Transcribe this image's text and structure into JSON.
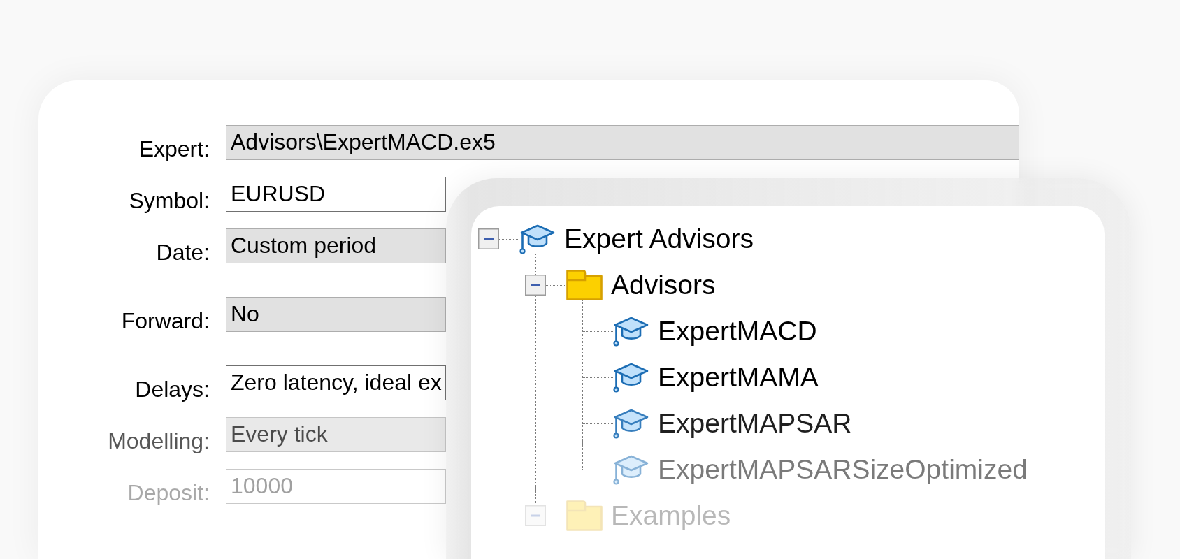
{
  "form": {
    "groups": [
      {
        "rows": [
          {
            "label": "Expert:",
            "value": "Advisors\\ExpertMACD.ex5",
            "kind": "combo"
          },
          {
            "label": "Symbol:",
            "value": "EURUSD",
            "kind": "input"
          },
          {
            "label": "Date:",
            "value": "Custom period",
            "kind": "combo"
          }
        ]
      },
      {
        "rows": [
          {
            "label": "Forward:",
            "value": "No",
            "kind": "combo"
          }
        ]
      },
      {
        "rows": [
          {
            "label": "Delays:",
            "value": "Zero latency, ideal ex",
            "kind": "input"
          },
          {
            "label": "Modelling:",
            "value": "Every tick",
            "kind": "combo"
          },
          {
            "label": "Deposit:",
            "value": "10000",
            "kind": "input"
          }
        ]
      }
    ]
  },
  "navigator": {
    "tree": [
      {
        "label": "Expert Advisors",
        "kind": "expert",
        "expanded": true,
        "children": [
          {
            "label": "Advisors",
            "kind": "folder",
            "expanded": true,
            "children": [
              {
                "label": "ExpertMACD",
                "kind": "expert"
              },
              {
                "label": "ExpertMAMA",
                "kind": "expert"
              },
              {
                "label": "ExpertMAPSAR",
                "kind": "expert"
              },
              {
                "label": "ExpertMAPSARSizeOptimized",
                "kind": "expert"
              }
            ]
          },
          {
            "label": "Examples",
            "kind": "folder",
            "expanded": true
          }
        ]
      }
    ]
  }
}
